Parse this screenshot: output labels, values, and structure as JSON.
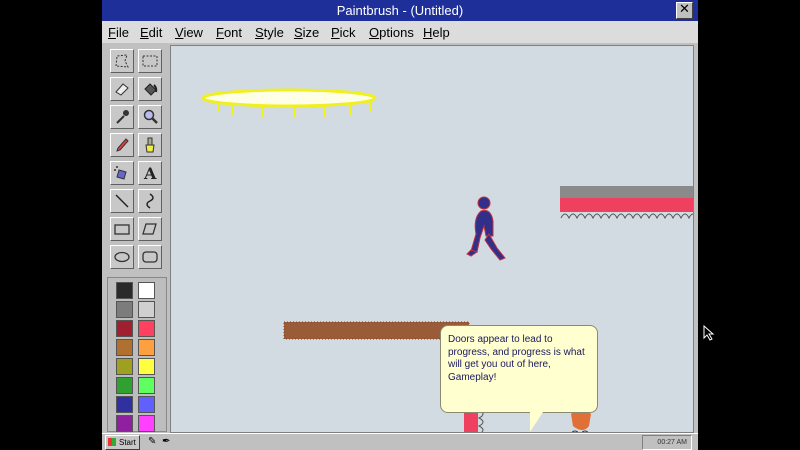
{
  "window": {
    "title": "Paintbrush - (Untitled)",
    "close_glyph": "✕"
  },
  "menu": [
    "File",
    "Edit",
    "View",
    "Font",
    "Style",
    "Size",
    "Pick",
    "Options",
    "Help"
  ],
  "tools": [
    {
      "name": "free-select-icon"
    },
    {
      "name": "rect-select-icon"
    },
    {
      "name": "eraser-icon"
    },
    {
      "name": "fill-bucket-icon"
    },
    {
      "name": "eyedropper-icon"
    },
    {
      "name": "magnifier-icon"
    },
    {
      "name": "pencil-icon"
    },
    {
      "name": "brush-icon"
    },
    {
      "name": "airbrush-icon"
    },
    {
      "name": "text-tool-icon",
      "label": "A"
    },
    {
      "name": "line-icon"
    },
    {
      "name": "curve-icon"
    },
    {
      "name": "rectangle-icon"
    },
    {
      "name": "polygon-icon"
    },
    {
      "name": "ellipse-icon"
    },
    {
      "name": "rounded-rect-icon"
    }
  ],
  "palette": [
    "#2a2a2a",
    "#ffffff",
    "#7c7c7c",
    "#d0d0d0",
    "#a02030",
    "#ff4060",
    "#b07030",
    "#ffa040",
    "#a0a020",
    "#ffff40",
    "#30a030",
    "#60ff60",
    "#3030a0",
    "#6060ff",
    "#9020a0",
    "#ff40ff"
  ],
  "speech": {
    "text": "Doors appear to lead to progress, and progress is what will get you out of here, Gameplay!"
  },
  "taskbar": {
    "start_label": "Start",
    "clock": "00:27 AM"
  },
  "colors": {
    "title_bar": "#1e2f9a",
    "canvas_bg": "#d2dae2",
    "trampoline": "#ffff40",
    "platform_red": "#f04060",
    "platform_gray": "#8a8a8a",
    "platform_brown": "#9a5c38",
    "player": "#30308a",
    "character_orange": "#e07038",
    "door_blue": "#6060ff"
  }
}
